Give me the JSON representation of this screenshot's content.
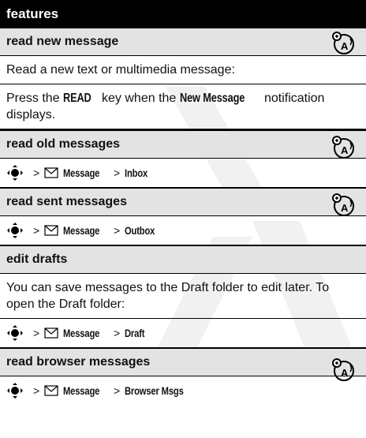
{
  "header": {
    "title": "features"
  },
  "sections": [
    {
      "title": "read new message",
      "intro": "Read a new text or multimedia message:",
      "press_prefix": "Press the ",
      "key": "READ",
      "press_mid": " key when the ",
      "notification": "New Message",
      "press_suffix": " notification displays."
    },
    {
      "title": "read old messages",
      "path_root": "Message",
      "path_leaf": "Inbox"
    },
    {
      "title": "read sent messages",
      "path_root": "Message",
      "path_leaf": "Outbox"
    },
    {
      "title": "edit drafts",
      "intro": "You can save messages to the Draft folder to edit later. To open the Draft folder:",
      "path_root": "Message",
      "path_leaf": "Draft"
    },
    {
      "title": "read browser messages",
      "path_root": "Message",
      "path_leaf": "Browser Msgs"
    }
  ],
  "icons": {
    "nav_key": "nav-key-icon",
    "message": "envelope-icon",
    "network_feature": "network-feature-icon"
  },
  "symbols": {
    "separator": ">"
  }
}
